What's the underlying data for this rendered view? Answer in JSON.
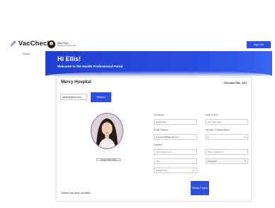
{
  "app": {
    "brand_name": "VacCheck",
    "nav_home": "Home"
  },
  "user": {
    "name": "Ellis Pian",
    "role": "Health Professional"
  },
  "header": {
    "signout_label": "Sign Out"
  },
  "banner": {
    "greeting": "Hi Ellis!",
    "subtitle": "Welcome to the Health Professional Portal"
  },
  "card": {
    "hospital": "Mercy Hospital",
    "date": "December 15th, 2021",
    "search": {
      "value": "nakok@gmail.com",
      "button_label": "Search"
    },
    "photo": {
      "change_label": "Change Profile Photo"
    },
    "form": {
      "full_name": {
        "label": "Full Name",
        "value": "Jennie Kim"
      },
      "dob": {
        "label": "Date of Birth",
        "value": "mm / dd / yyyy"
      },
      "email": {
        "label": "Email Address",
        "value": "jennekim98@gmail.com"
      },
      "vaccinations": {
        "label": "Number of Vaccinations",
        "value": "0"
      },
      "address_label": "Address",
      "street1": {
        "placeholder": "Street Address 1"
      },
      "street2": {
        "placeholder": "Street Address 2"
      },
      "city": {
        "placeholder": "City"
      },
      "state": {
        "value": "Arkansas"
      },
      "postal": {
        "placeholder": "Postal Code"
      }
    },
    "modify_label": "Modify Patient",
    "status": "Patient has been modified"
  },
  "colors": {
    "accent": "#2f4fe0",
    "banner": "#1f3fd0"
  }
}
